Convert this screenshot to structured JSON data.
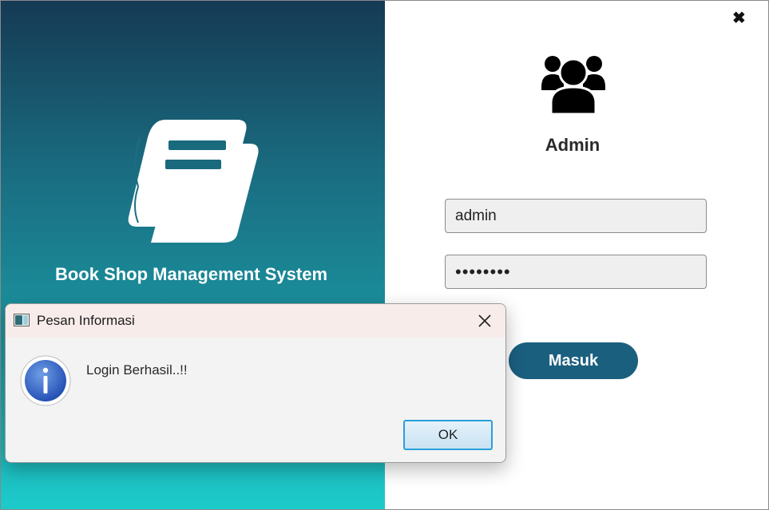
{
  "app": {
    "title": "Book Shop Management System",
    "close_symbol": "✖",
    "role_title": "Admin"
  },
  "login": {
    "username_value": "admin",
    "password_value": "••••••••",
    "submit_label": "Masuk"
  },
  "dialog": {
    "title": "Pesan Informasi",
    "message": "Login Berhasil..!!",
    "ok_label": "OK"
  },
  "icons": {
    "book": "book-icon",
    "users": "users-icon",
    "info": "info-icon",
    "close": "close-icon"
  },
  "colors": {
    "panel_top": "#153a54",
    "panel_bottom": "#1dcbcb",
    "accent": "#1b5f7f",
    "info_blue": "#2f66c8",
    "ok_border": "#2a9fd8"
  }
}
